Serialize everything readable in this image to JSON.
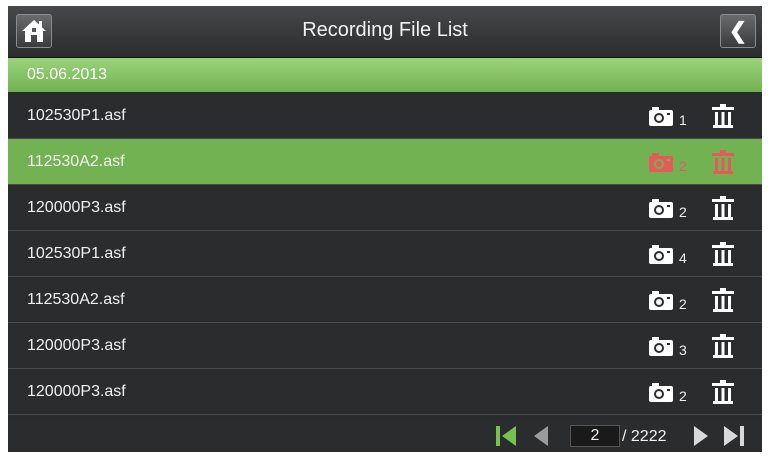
{
  "header": {
    "title": "Recording File List",
    "back_glyph": "❮"
  },
  "date_group": {
    "date": "05.06.2013"
  },
  "colors": {
    "accent_green": "#72b252",
    "selected_icon_red": "#e85a5a",
    "icon_white": "#ffffff"
  },
  "files": [
    {
      "name": "102530P1.asf",
      "photo_count": "1",
      "selected": false
    },
    {
      "name": "112530A2.asf",
      "photo_count": "2",
      "selected": true
    },
    {
      "name": "120000P3.asf",
      "photo_count": "2",
      "selected": false
    },
    {
      "name": "102530P1.asf",
      "photo_count": "4",
      "selected": false
    },
    {
      "name": "112530A2.asf",
      "photo_count": "2",
      "selected": false
    },
    {
      "name": "120000P3.asf",
      "photo_count": "3",
      "selected": false
    },
    {
      "name": "120000P3.asf",
      "photo_count": "2",
      "selected": false
    }
  ],
  "pagination": {
    "current_page": "2",
    "total_pages": "/ 2222"
  }
}
